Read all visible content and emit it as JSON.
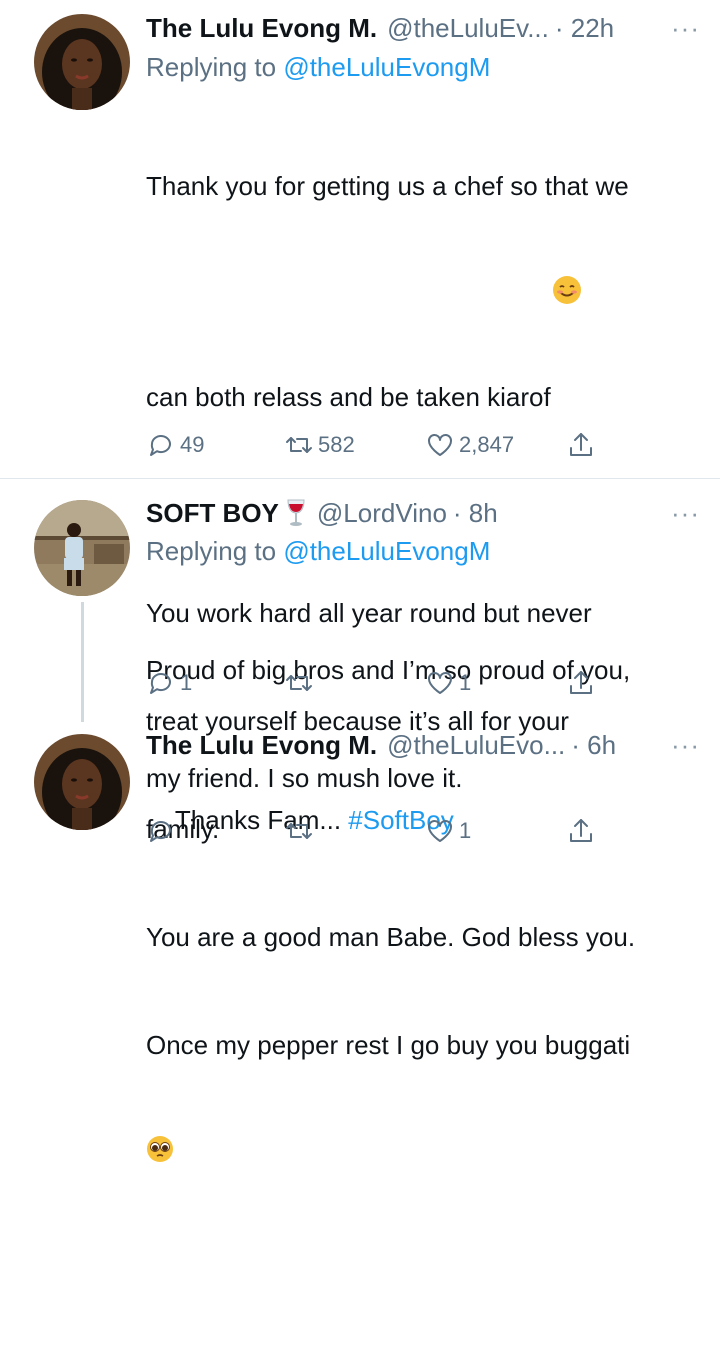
{
  "tweets": [
    {
      "name": "The Lulu Evong M.",
      "handle": "@theLuluEv...",
      "time": "· 22h",
      "more": "···",
      "replying_prefix": "Replying to ",
      "replying_to": "@theLuluEvongM",
      "lines": [
        "Thank you for getting us a chef so that we",
        "can both relass and be taken kiarof",
        "",
        "You work hard all year round but never",
        "treat yourself because it’s all for your",
        "family.",
        "You are a good man Babe. God bless you.",
        "Once my pepper rest I go buy you buggati"
      ],
      "emoji_1": "smiling-face-emoji",
      "emoji_2": "pleading-face-emoji",
      "replies": "49",
      "retweets": "582",
      "likes": "2,847"
    },
    {
      "name": "SOFT BOY",
      "name_emoji": "wine-glass-emoji",
      "handle": "@LordVino",
      "time": "· 8h",
      "more": "···",
      "replying_prefix": "Replying to ",
      "replying_to": "@theLuluEvongM",
      "lines": [
        "Proud of big bros and I’m so proud of you,",
        "my friend. I so mush love it."
      ],
      "replies": "1",
      "retweets": "",
      "likes": "1"
    },
    {
      "name": "The Lulu Evong M.",
      "handle": "@theLuluEvo...",
      "time": "· 6h",
      "more": "···",
      "body_text": "Thanks Fam... ",
      "hashtag": "#SoftBoy",
      "replies": "",
      "retweets": "",
      "likes": "1"
    }
  ],
  "colors": {
    "link": "#1d9bf0",
    "secondary_text": "#5b7083",
    "divider": "#e1e8ed"
  }
}
